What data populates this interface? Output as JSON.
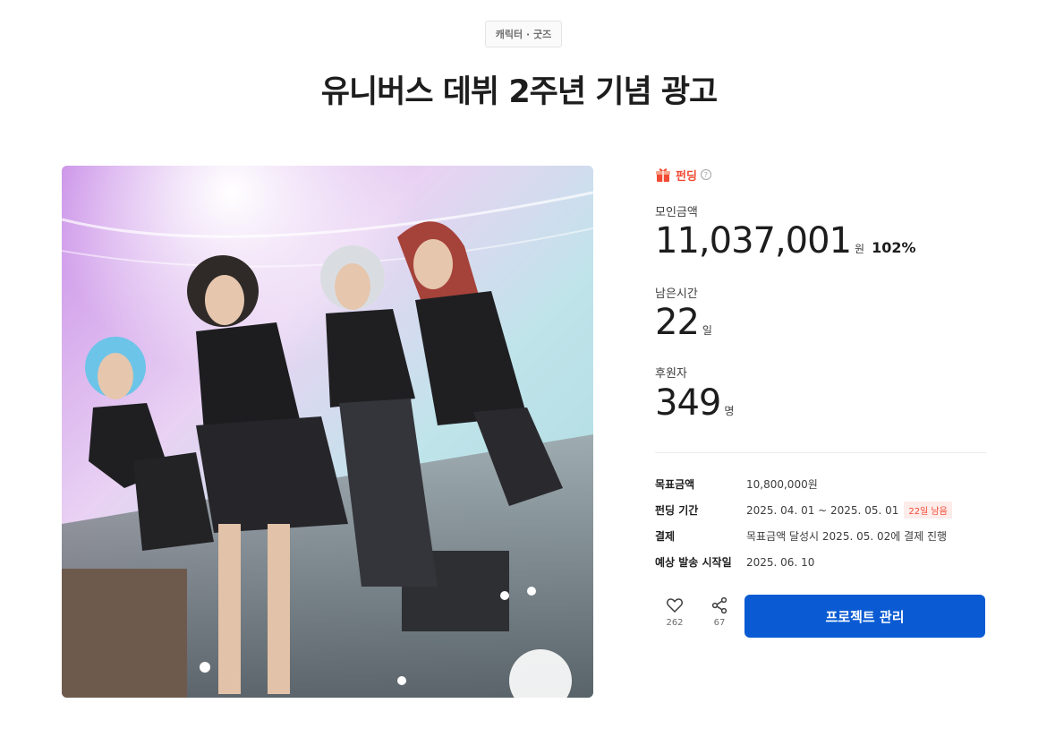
{
  "category": "캐릭터 · 굿즈",
  "title": "유니버스 데뷔 2주년 기념 광고",
  "status": {
    "label": "펀딩",
    "help_glyph": "?",
    "color": "#f24a35"
  },
  "stats": {
    "raised": {
      "label": "모인금액",
      "value": "11,037,001",
      "unit": "원",
      "rate": "102%"
    },
    "remaining": {
      "label": "남은시간",
      "value": "22",
      "unit": "일"
    },
    "backers": {
      "label": "후원자",
      "value": "349",
      "unit": "명"
    }
  },
  "info": {
    "goal": {
      "key": "목표금액",
      "value": "10,800,000원"
    },
    "period": {
      "key": "펀딩 기간",
      "value": "2025. 04. 01 ~ 2025. 05. 01",
      "badge": "22일 남음"
    },
    "payment": {
      "key": "결제",
      "value": "목표금액 달성시 2025. 05. 02에 결제 진행"
    },
    "shipping": {
      "key": "예상 발송 시작일",
      "value": "2025. 06. 10"
    }
  },
  "actions": {
    "likes": {
      "icon": "heart-icon",
      "count": "262"
    },
    "shares": {
      "icon": "share-icon",
      "count": "67"
    },
    "manage_label": "프로젝트 관리"
  },
  "colors": {
    "accent_blue": "#0a5bd3",
    "accent_red": "#f24a35"
  }
}
